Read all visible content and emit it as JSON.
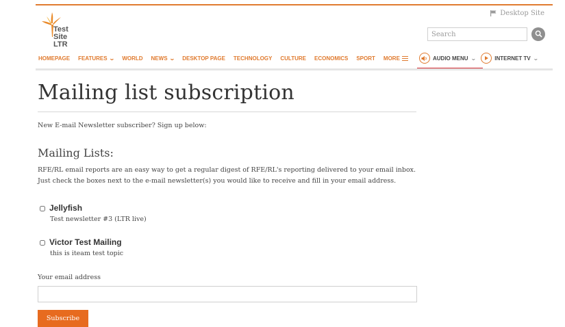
{
  "header": {
    "desktop_site": "Desktop Site",
    "logo_line1": "Test Site",
    "logo_line2": "LTR",
    "search_placeholder": "Search"
  },
  "nav": {
    "items": [
      {
        "label": "HOMEPAGE",
        "has_dropdown": false
      },
      {
        "label": "FEATURES",
        "has_dropdown": true
      },
      {
        "label": "WORLD",
        "has_dropdown": false
      },
      {
        "label": "NEWS",
        "has_dropdown": true
      },
      {
        "label": "DESKTOP PAGE",
        "has_dropdown": false
      },
      {
        "label": "TECHNOLOGY",
        "has_dropdown": false
      },
      {
        "label": "CULTURE",
        "has_dropdown": false
      },
      {
        "label": "ECONOMICS",
        "has_dropdown": false
      },
      {
        "label": "SPORT",
        "has_dropdown": false
      },
      {
        "label": "MORE",
        "has_dropdown": false
      }
    ],
    "audio_menu": "AUDIO MENU",
    "internet_tv": "INTERNET TV"
  },
  "main": {
    "title": "Mailing list subscription",
    "intro": "New E-mail Newsletter subscriber? Sign up below:",
    "lists_heading": "Mailing Lists:",
    "description_line1": "RFE/RL email reports are an easy way to get a regular digest of RFE/RL's reporting delivered to your email inbox.",
    "description_line2": "Just check the boxes next to the e-mail newsletter(s) you would like to receive and fill in your email address.",
    "newsletters": [
      {
        "name": "Jellyfish",
        "description": "Test newsletter #3 (LTR live)",
        "checked": false
      },
      {
        "name": "Victor Test Mailing",
        "description": "this is iteam test topic",
        "checked": false
      }
    ],
    "email_label": "Your email address",
    "email_value": "",
    "subscribe_label": "Subscribe"
  },
  "colors": {
    "accent": "#e07a2e",
    "button": "#e76b1f",
    "audio_underline": "#d0262c"
  },
  "icons": [
    "flag-icon",
    "logo-bird-icon",
    "search-icon",
    "chevron-down-icon",
    "menu-icon",
    "speaker-icon",
    "play-icon"
  ]
}
